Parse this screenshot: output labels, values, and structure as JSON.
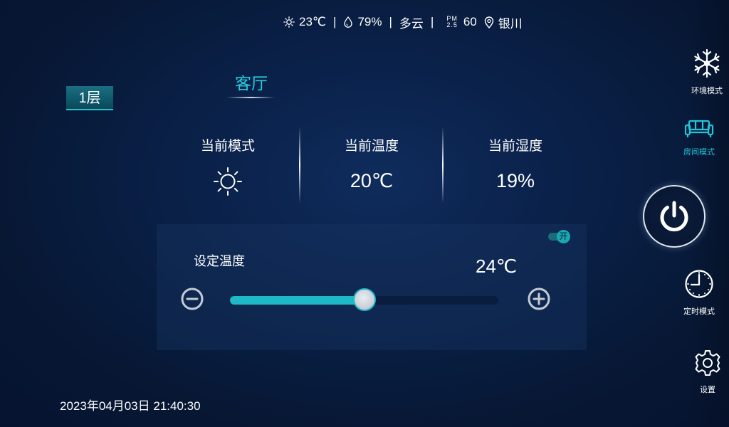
{
  "status_bar": {
    "temperature": "23℃",
    "humidity": "79%",
    "weather": "多云",
    "pm_label_top": "PM",
    "pm_label_bottom": "2.5",
    "pm_value": "60",
    "city": "银川",
    "separator": "|"
  },
  "floor": {
    "label": "1层"
  },
  "room": {
    "name": "客厅"
  },
  "info": {
    "mode_label": "当前模式",
    "mode_icon": "sun-icon",
    "temp_label": "当前温度",
    "temp_value": "20℃",
    "humidity_label": "当前湿度",
    "humidity_value": "19%"
  },
  "setting": {
    "label": "设定温度",
    "value": "24℃",
    "slider_fraction": 0.5,
    "toggle_text": "开",
    "toggle_on": true
  },
  "datetime": "2023年04月03日 21:40:30",
  "sidebar": {
    "items": [
      {
        "label": "环境模式",
        "icon": "snowflake-icon",
        "active": false
      },
      {
        "label": "房间模式",
        "icon": "sofa-icon",
        "active": true
      },
      {
        "label": "定时模式",
        "icon": "clock-icon",
        "active": false
      },
      {
        "label": "设置",
        "icon": "gear-icon",
        "active": false
      }
    ],
    "power_icon": "power-icon"
  },
  "colors": {
    "accent": "#21d0e0",
    "slider_fill": "#1fb8c6",
    "background": "#0a2149"
  }
}
